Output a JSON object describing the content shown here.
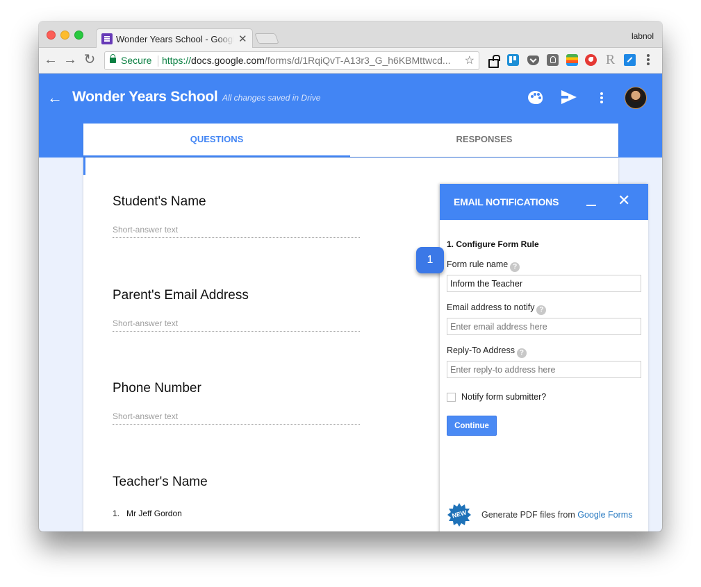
{
  "browser": {
    "tab_title": "Wonder Years School - Google Forms",
    "profile_name": "labnol",
    "secure_label": "Secure",
    "url_scheme": "https://",
    "url_host": "docs.google.com",
    "url_path": "/forms/d/1RqiQvT-A13r3_G_h6KBMttwcd...",
    "extensions": [
      "lock-icon",
      "trello-icon",
      "pocket-icon",
      "bulb-icon",
      "stack-icon",
      "red-circle-icon",
      "r-icon",
      "external-link-icon"
    ],
    "extension_r_label": "R"
  },
  "header": {
    "back_icon": "←",
    "title": "Wonder Years School",
    "save_status": "All changes saved in Drive",
    "accent_color": "#4285f4"
  },
  "tabs": [
    {
      "label": "QUESTIONS",
      "active": true
    },
    {
      "label": "RESPONSES",
      "active": false
    }
  ],
  "questions": [
    {
      "title": "Student's Name",
      "answer_hint": "Short-answer text"
    },
    {
      "title": "Parent's Email Address",
      "answer_hint": "Short-answer text"
    },
    {
      "title": "Phone Number",
      "answer_hint": "Short-answer text"
    },
    {
      "title": "Teacher's Name",
      "option_number": "1.",
      "option_label": "Mr Jeff Gordon"
    }
  ],
  "email_panel": {
    "title": "EMAIL NOTIFICATIONS",
    "close_icon": "✕",
    "step_title": "1. Configure Form Rule",
    "rule_name_label": "Form rule name",
    "rule_name_value": "Inform the Teacher",
    "email_label": "Email address to notify",
    "email_placeholder": "Enter email address here",
    "reply_label": "Reply-To Address",
    "reply_placeholder": "Enter reply-to address here",
    "notify_submitter_label": "Notify form submitter?",
    "notify_submitter_checked": false,
    "continue_label": "Continue",
    "help_glyph": "?",
    "footer_badge": "NEW",
    "footer_text": "Generate PDF files from ",
    "footer_link": "Google Forms"
  },
  "callout": {
    "label": "1"
  }
}
